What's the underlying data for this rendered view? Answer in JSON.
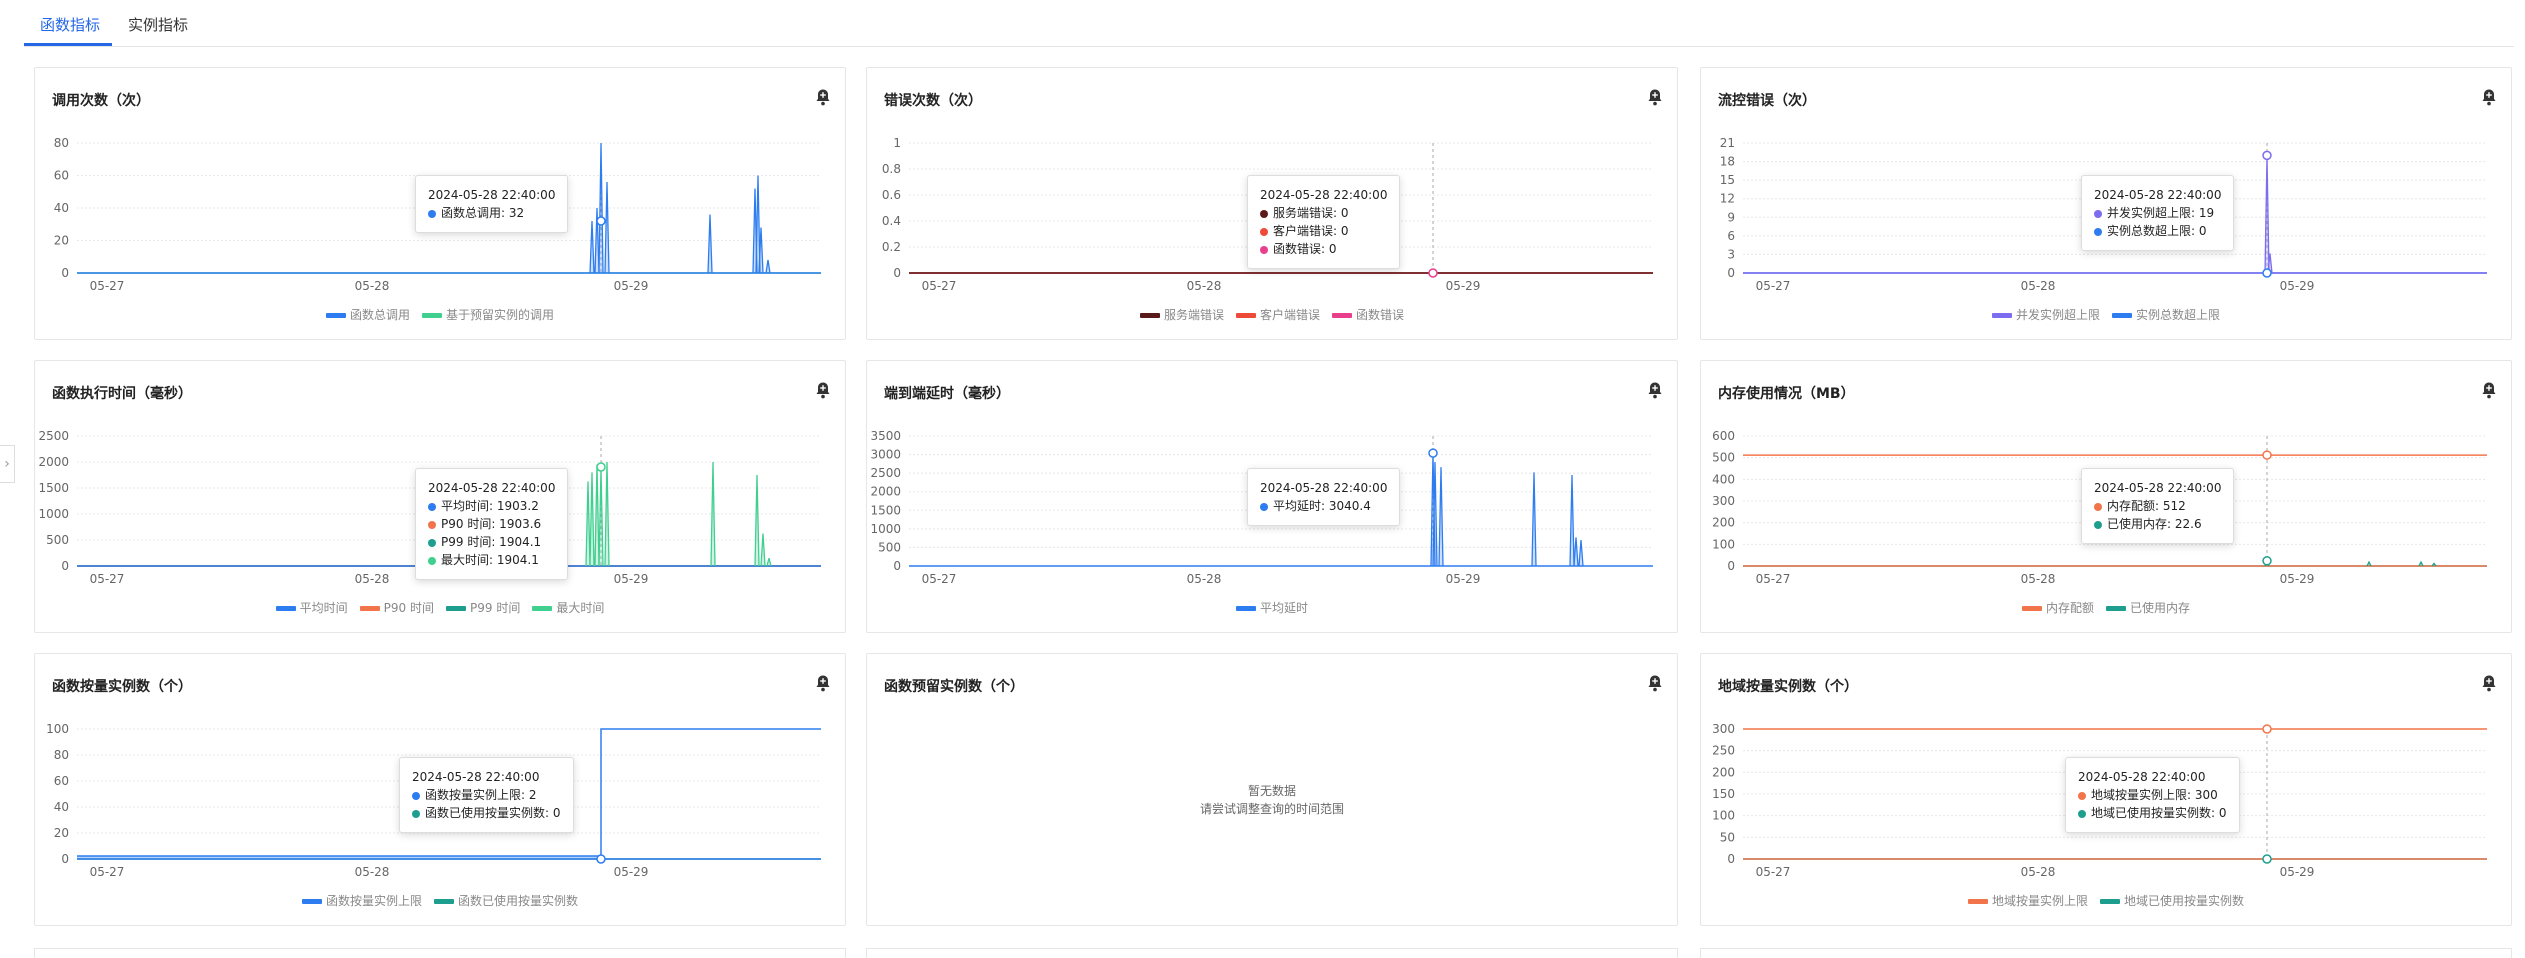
{
  "tabs": [
    {
      "label": "函数指标"
    },
    {
      "label": "实例指标"
    }
  ],
  "colors": {
    "blue": "#2e7df0",
    "green": "#3fcf8e",
    "purple": "#7b6cf0",
    "darkred": "#5a1a1a",
    "red": "#ee4a3a",
    "pink": "#e83e8c",
    "orange": "#f2744a",
    "teal": "#1e9e8e",
    "accent": "#2468e6"
  },
  "icons": {
    "alarm": "bell-icon",
    "collapse": "chevron-right-icon"
  },
  "empty_state": {
    "line1": "暂无数据",
    "line2": "请尝试调整查询的时间范围"
  },
  "cards": [
    {
      "title": "调用次数（次）",
      "chart_data": {
        "type": "line",
        "x_ticks": [
          "05-27",
          "05-28",
          "05-29"
        ],
        "y_ticks": [
          "0",
          "20",
          "40",
          "60",
          "80"
        ],
        "series": [
          {
            "name": "函数总调用",
            "color": "#2e7df0"
          },
          {
            "name": "基于预留实例的调用",
            "color": "#3fcf8e"
          }
        ]
      },
      "tooltip": {
        "time": "2024-05-28 22:40:00",
        "rows": [
          {
            "text": "函数总调用: 32",
            "color": "#2e7df0"
          }
        ]
      }
    },
    {
      "title": "错误次数（次）",
      "chart_data": {
        "type": "line",
        "x_ticks": [
          "05-27",
          "05-28",
          "05-29"
        ],
        "y_ticks": [
          "0",
          "0.2",
          "0.4",
          "0.6",
          "0.8",
          "1"
        ],
        "series": [
          {
            "name": "服务端错误",
            "color": "#5a1a1a"
          },
          {
            "name": "客户端错误",
            "color": "#ee4a3a"
          },
          {
            "name": "函数错误",
            "color": "#e83e8c"
          }
        ]
      },
      "tooltip": {
        "time": "2024-05-28 22:40:00",
        "rows": [
          {
            "text": "服务端错误: 0",
            "color": "#5a1a1a"
          },
          {
            "text": "客户端错误: 0",
            "color": "#ee4a3a"
          },
          {
            "text": "函数错误: 0",
            "color": "#e83e8c"
          }
        ]
      }
    },
    {
      "title": "流控错误（次）",
      "chart_data": {
        "type": "line",
        "x_ticks": [
          "05-27",
          "05-28",
          "05-29"
        ],
        "y_ticks": [
          "0",
          "3",
          "6",
          "9",
          "12",
          "15",
          "18",
          "21"
        ],
        "series": [
          {
            "name": "并发实例超上限",
            "color": "#7b6cf0"
          },
          {
            "name": "实例总数超上限",
            "color": "#2e7df0"
          }
        ]
      },
      "tooltip": {
        "time": "2024-05-28 22:40:00",
        "rows": [
          {
            "text": "并发实例超上限: 19",
            "color": "#7b6cf0"
          },
          {
            "text": "实例总数超上限: 0",
            "color": "#2e7df0"
          }
        ]
      }
    },
    {
      "title": "函数执行时间（毫秒）",
      "chart_data": {
        "type": "line",
        "x_ticks": [
          "05-27",
          "05-28",
          "05-29"
        ],
        "y_ticks": [
          "0",
          "500",
          "1000",
          "1500",
          "2000",
          "2500"
        ],
        "series": [
          {
            "name": "平均时间",
            "color": "#2e7df0"
          },
          {
            "name": "P90 时间",
            "color": "#f2744a"
          },
          {
            "name": "P99 时间",
            "color": "#1e9e8e"
          },
          {
            "name": "最大时间",
            "color": "#3fcf8e"
          }
        ]
      },
      "tooltip": {
        "time": "2024-05-28 22:40:00",
        "rows": [
          {
            "text": "平均时间: 1903.2",
            "color": "#2e7df0"
          },
          {
            "text": "P90 时间: 1903.6",
            "color": "#f2744a"
          },
          {
            "text": "P99 时间: 1904.1",
            "color": "#1e9e8e"
          },
          {
            "text": "最大时间: 1904.1",
            "color": "#3fcf8e"
          }
        ]
      }
    },
    {
      "title": "端到端延时（毫秒）",
      "chart_data": {
        "type": "line",
        "x_ticks": [
          "05-27",
          "05-28",
          "05-29"
        ],
        "y_ticks": [
          "0",
          "500",
          "1000",
          "1500",
          "2000",
          "2500",
          "3000",
          "3500"
        ],
        "series": [
          {
            "name": "平均延时",
            "color": "#2e7df0"
          }
        ]
      },
      "tooltip": {
        "time": "2024-05-28 22:40:00",
        "rows": [
          {
            "text": "平均延时: 3040.4",
            "color": "#2e7df0"
          }
        ]
      }
    },
    {
      "title": "内存使用情况（MB）",
      "chart_data": {
        "type": "line",
        "x_ticks": [
          "05-27",
          "05-28",
          "05-29"
        ],
        "y_ticks": [
          "0",
          "100",
          "200",
          "300",
          "400",
          "500",
          "600"
        ],
        "series": [
          {
            "name": "内存配额",
            "color": "#f2744a"
          },
          {
            "name": "已使用内存",
            "color": "#1e9e8e"
          }
        ]
      },
      "tooltip": {
        "time": "2024-05-28 22:40:00",
        "rows": [
          {
            "text": "内存配额: 512",
            "color": "#f2744a"
          },
          {
            "text": "已使用内存: 22.6",
            "color": "#1e9e8e"
          }
        ]
      }
    },
    {
      "title": "函数按量实例数（个）",
      "chart_data": {
        "type": "line",
        "x_ticks": [
          "05-27",
          "05-28",
          "05-29"
        ],
        "y_ticks": [
          "0",
          "20",
          "40",
          "60",
          "80",
          "100"
        ],
        "series": [
          {
            "name": "函数按量实例上限",
            "color": "#2e7df0"
          },
          {
            "name": "函数已使用按量实例数",
            "color": "#1e9e8e"
          }
        ]
      },
      "tooltip": {
        "time": "2024-05-28 22:40:00",
        "rows": [
          {
            "text": "函数按量实例上限: 2",
            "color": "#2e7df0"
          },
          {
            "text": "函数已使用按量实例数: 0",
            "color": "#1e9e8e"
          }
        ]
      }
    },
    {
      "title": "函数预留实例数（个）",
      "chart_data": null,
      "tooltip": null
    },
    {
      "title": "地域按量实例数（个）",
      "chart_data": {
        "type": "line",
        "x_ticks": [
          "05-27",
          "05-28",
          "05-29"
        ],
        "y_ticks": [
          "0",
          "50",
          "100",
          "150",
          "200",
          "250",
          "300"
        ],
        "series": [
          {
            "name": "地域按量实例上限",
            "color": "#f2744a"
          },
          {
            "name": "地域已使用按量实例数",
            "color": "#1e9e8e"
          }
        ]
      },
      "tooltip": {
        "time": "2024-05-28 22:40:00",
        "rows": [
          {
            "text": "地域按量实例上限: 300",
            "color": "#f2744a"
          },
          {
            "text": "地域已使用按量实例数: 0",
            "color": "#1e9e8e"
          }
        ]
      }
    }
  ]
}
